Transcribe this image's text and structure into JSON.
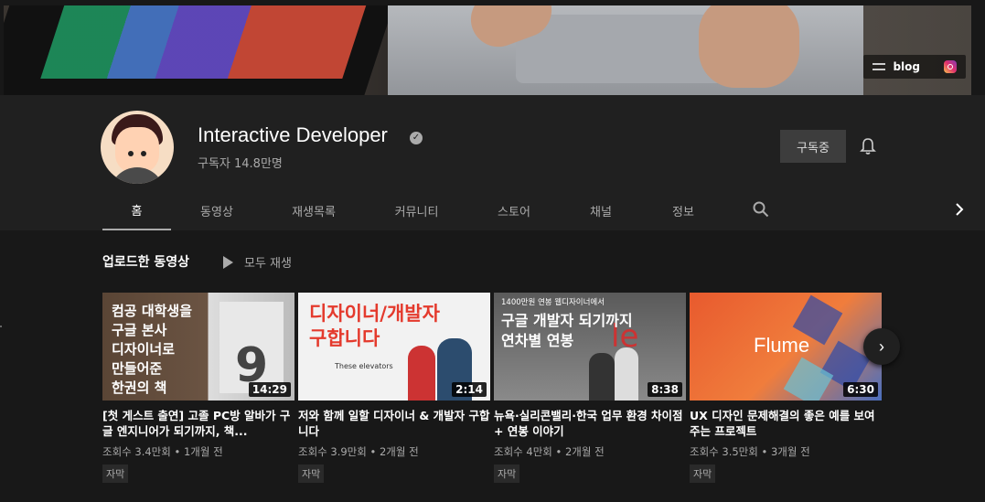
{
  "banner": {
    "links": [
      {
        "label": "blog",
        "icon": "blog-icon"
      },
      {
        "label": "",
        "icon": "instagram-icon"
      }
    ]
  },
  "channel": {
    "name": "Interactive Developer",
    "subscribers": "구독자 14.8만명",
    "subscribe_button": "구독중"
  },
  "tabs": [
    "홈",
    "동영상",
    "재생목록",
    "커뮤니티",
    "스토어",
    "채널",
    "정보"
  ],
  "section": {
    "title": "업로드한 동영상",
    "play_all": "모두 재생"
  },
  "videos": [
    {
      "thumb_text": "컴공 대학생을\n구글 본사\n디자이너로\n만들어준\n한권의 책",
      "duration": "14:29",
      "title": "[첫 게스트 출연] 고졸 PC방 알바가 구글 엔지니어가 되기까지, 책...",
      "meta": "조회수 3.4만회 • 1개월 전",
      "badge": "자막"
    },
    {
      "thumb_text": "디자이너/개발자\n구합니다",
      "thumb_small": "These elevators",
      "duration": "2:14",
      "title": "저와 함께 일할 디자이너 & 개발자 구합니다",
      "meta": "조회수 3.9만회 • 2개월 전",
      "badge": "자막"
    },
    {
      "thumb_top": "1400만원 연봉 웹디자이너에서",
      "thumb_text": "구글 개발자 되기까지\n연차별 연봉",
      "duration": "8:38",
      "title": "뉴욕·실리콘밸리·한국 업무 환경 차이점 + 연봉 이야기",
      "meta": "조회수 4만회 • 2개월 전",
      "badge": "자막"
    },
    {
      "thumb_text": "Flume",
      "duration": "6:30",
      "title": "UX 디자인 문제해결의 좋은 예를 보여주는 프로젝트",
      "meta": "조회수 3.5만회 • 3개월 전",
      "badge": "자막"
    }
  ],
  "colors": {
    "background": "#181818",
    "header": "#202020",
    "subscribed_button": "#3d3d3d",
    "secondary_text": "#aaaaaa"
  }
}
